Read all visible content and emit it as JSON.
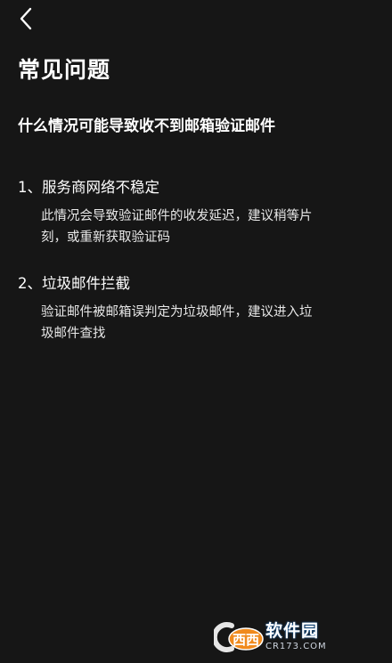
{
  "header": {
    "back_icon": "chevron-left-icon"
  },
  "page": {
    "title": "常见问题",
    "section_heading": "什么情况可能导致收不到邮箱验证邮件"
  },
  "faq": [
    {
      "title": "1、服务商网络不稳定",
      "body_lines": [
        "此情况会导致验证邮件的收发延迟，建议稍等片",
        "刻，或重新获取验证码"
      ]
    },
    {
      "title": "2、垃圾邮件拦截",
      "body_lines": [
        "验证邮件被邮箱误判定为垃圾邮件，建议进入垃",
        "圾邮件查找"
      ]
    }
  ],
  "watermark": {
    "logo_text": "西西",
    "site_name": "软件园",
    "site_domain": "CR173.COM"
  },
  "colors": {
    "background": "#161616",
    "text": "#ffffff",
    "watermark_blue": "#1b6fc2",
    "watermark_orange": "#f08a1c"
  }
}
